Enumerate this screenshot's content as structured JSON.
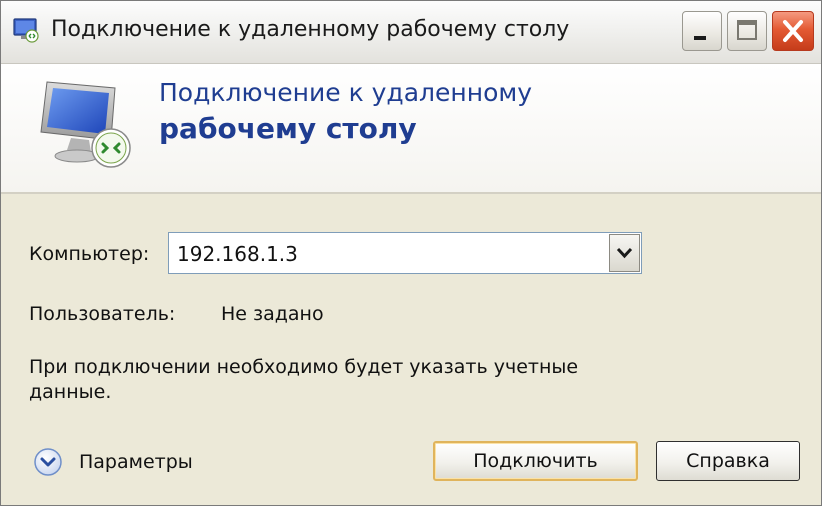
{
  "window": {
    "title": "Подключение к удаленному рабочему столу",
    "icons": {
      "app": "remote-desktop-icon",
      "minimize": "minimize-icon",
      "maximize": "maximize-icon",
      "close": "close-icon"
    },
    "colors": {
      "close_button": "#e45a34",
      "banner_text": "#1f3d91",
      "dialog_background": "#ece9d8"
    }
  },
  "banner": {
    "line1": "Подключение к удаленному",
    "line2": "рабочему столу",
    "icon": "remote-desktop-monitor-icon"
  },
  "form": {
    "computer_label": "Компьютер:",
    "computer_value": "192.168.1.3",
    "user_label": "Пользователь:",
    "user_value": "Не задано",
    "notice_line1": "При подключении необходимо будет указать учетные",
    "notice_line2": "данные."
  },
  "footer": {
    "options_label": "Параметры",
    "options_icon": "chevron-down-circle-icon",
    "connect_label": "Подключить",
    "help_label": "Справка"
  }
}
